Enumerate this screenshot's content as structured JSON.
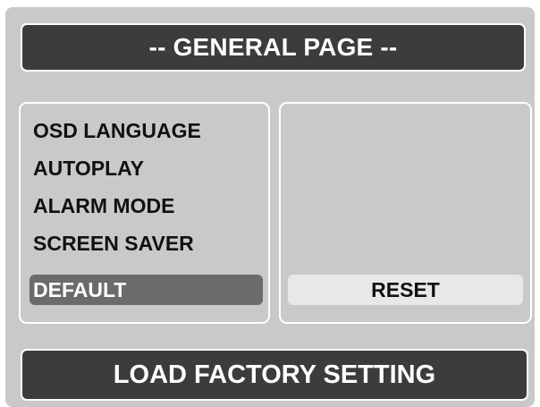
{
  "header": {
    "title": "-- GENERAL PAGE --"
  },
  "menu": {
    "items": [
      {
        "label": "OSD LANGUAGE",
        "selected": false
      },
      {
        "label": "AUTOPLAY",
        "selected": false
      },
      {
        "label": "ALARM MODE",
        "selected": false
      },
      {
        "label": "SCREEN SAVER",
        "selected": false
      },
      {
        "label": "DEFAULT",
        "selected": true
      }
    ]
  },
  "options": {
    "items": [
      {
        "label": "RESET",
        "highlighted": true
      }
    ]
  },
  "footer": {
    "description": "LOAD FACTORY SETTING"
  },
  "colors": {
    "background": "#c9c9c9",
    "bar": "#3c3c3c",
    "selected": "#6b6b6b",
    "option_highlight": "#e8e8e8",
    "border": "#ffffff"
  }
}
